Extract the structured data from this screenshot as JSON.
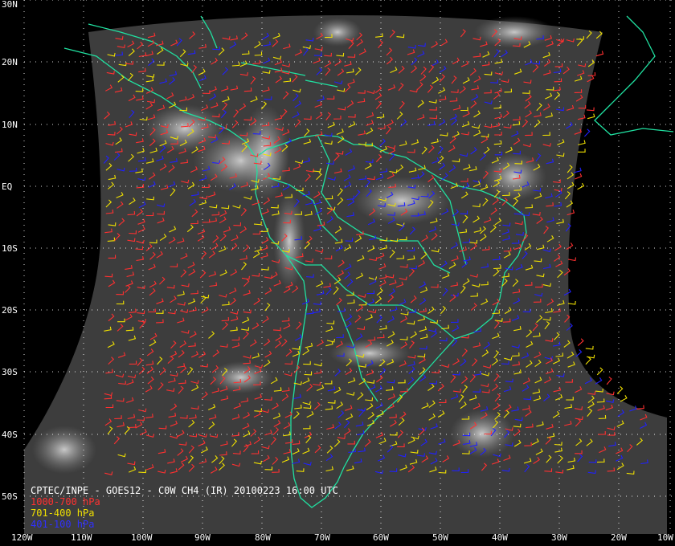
{
  "caption": {
    "title": "CPTEC/INPE - GOES12 - C0W CH4 (IR) 20100223 16:00 UTC"
  },
  "legend": [
    {
      "label": "1000-700 hPa",
      "color": "#ff3030"
    },
    {
      "label": "701-400 hPa",
      "color": "#f0e000"
    },
    {
      "label": "401-100 hPa",
      "color": "#2020ff"
    }
  ],
  "colors": {
    "coastline": "#20e0a0",
    "grid": "#ffffff",
    "satellite_background": "#3c3c3c"
  },
  "lat_labels": [
    "30N",
    "20N",
    "10N",
    "EQ",
    "10S",
    "20S",
    "30S",
    "40S",
    "50S"
  ],
  "lon_labels": [
    "120W",
    "110W",
    "100W",
    "90W",
    "80W",
    "70W",
    "60W",
    "50W",
    "40W",
    "30W",
    "20W",
    "10W"
  ]
}
